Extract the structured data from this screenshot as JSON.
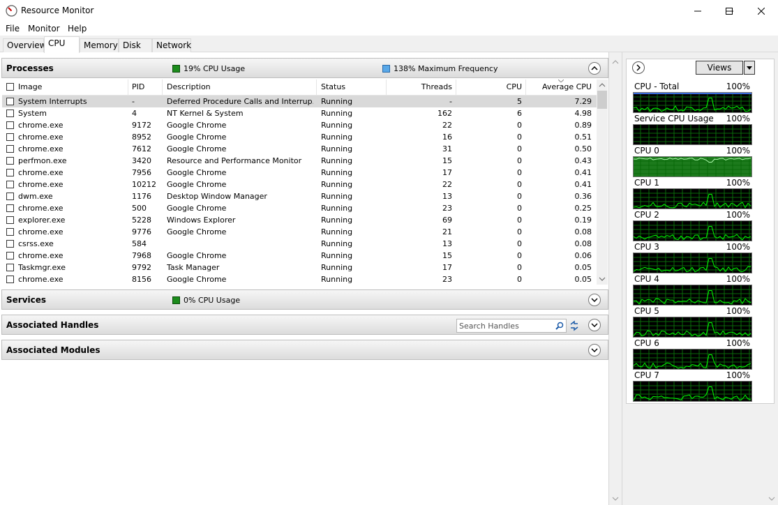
{
  "window": {
    "title": "Resource Monitor"
  },
  "menu": [
    "File",
    "Monitor",
    "Help"
  ],
  "tabs": [
    "Overview",
    "CPU",
    "Memory",
    "Disk",
    "Network"
  ],
  "processes": {
    "title": "Processes",
    "cpu_usage": "19% CPU Usage",
    "max_freq": "138% Maximum Frequency",
    "columns": [
      "Image",
      "PID",
      "Description",
      "Status",
      "Threads",
      "CPU",
      "Average CPU"
    ],
    "rows": [
      [
        "System Interrupts",
        "-",
        "Deferred Procedure Calls and Interrup...",
        "Running",
        "-",
        "5",
        "7.29"
      ],
      [
        "System",
        "4",
        "NT Kernel & System",
        "Running",
        "162",
        "6",
        "4.98"
      ],
      [
        "chrome.exe",
        "9172",
        "Google Chrome",
        "Running",
        "22",
        "0",
        "0.89"
      ],
      [
        "chrome.exe",
        "8952",
        "Google Chrome",
        "Running",
        "16",
        "0",
        "0.51"
      ],
      [
        "chrome.exe",
        "7612",
        "Google Chrome",
        "Running",
        "31",
        "0",
        "0.50"
      ],
      [
        "perfmon.exe",
        "3420",
        "Resource and Performance Monitor",
        "Running",
        "15",
        "0",
        "0.43"
      ],
      [
        "chrome.exe",
        "7956",
        "Google Chrome",
        "Running",
        "17",
        "0",
        "0.41"
      ],
      [
        "chrome.exe",
        "10212",
        "Google Chrome",
        "Running",
        "22",
        "0",
        "0.41"
      ],
      [
        "dwm.exe",
        "1176",
        "Desktop Window Manager",
        "Running",
        "13",
        "0",
        "0.36"
      ],
      [
        "chrome.exe",
        "500",
        "Google Chrome",
        "Running",
        "23",
        "0",
        "0.25"
      ],
      [
        "explorer.exe",
        "5228",
        "Windows Explorer",
        "Running",
        "69",
        "0",
        "0.19"
      ],
      [
        "chrome.exe",
        "9776",
        "Google Chrome",
        "Running",
        "21",
        "0",
        "0.08"
      ],
      [
        "csrss.exe",
        "584",
        "",
        "Running",
        "13",
        "0",
        "0.08"
      ],
      [
        "chrome.exe",
        "7968",
        "Google Chrome",
        "Running",
        "15",
        "0",
        "0.06"
      ],
      [
        "Taskmgr.exe",
        "9792",
        "Task Manager",
        "Running",
        "17",
        "0",
        "0.05"
      ],
      [
        "chrome.exe",
        "8156",
        "Google Chrome",
        "Running",
        "23",
        "0",
        "0.05"
      ]
    ]
  },
  "services": {
    "title": "Services",
    "cpu_usage": "0% CPU Usage"
  },
  "handles": {
    "title": "Associated Handles",
    "search_placeholder": "Search Handles"
  },
  "modules": {
    "title": "Associated Modules"
  },
  "right": {
    "views_label": "Views",
    "graphs": [
      {
        "label": "CPU - Total",
        "pct": "100%"
      },
      {
        "label": "Service CPU Usage",
        "pct": "100%"
      },
      {
        "label": "CPU 0",
        "pct": "100%"
      },
      {
        "label": "CPU 1",
        "pct": "100%"
      },
      {
        "label": "CPU 2",
        "pct": "100%"
      },
      {
        "label": "CPU 3",
        "pct": "100%"
      },
      {
        "label": "CPU 4",
        "pct": "100%"
      },
      {
        "label": "CPU 5",
        "pct": "100%"
      },
      {
        "label": "CPU 6",
        "pct": "100%"
      },
      {
        "label": "CPU 7",
        "pct": "100%"
      }
    ]
  },
  "colors": {
    "graph_bg": "#000000",
    "graph_line": "#00ff00",
    "cpu_swatch": "#1c8c1c",
    "freq_swatch": "#59a8e8",
    "header_top": "#f6f6f6"
  }
}
